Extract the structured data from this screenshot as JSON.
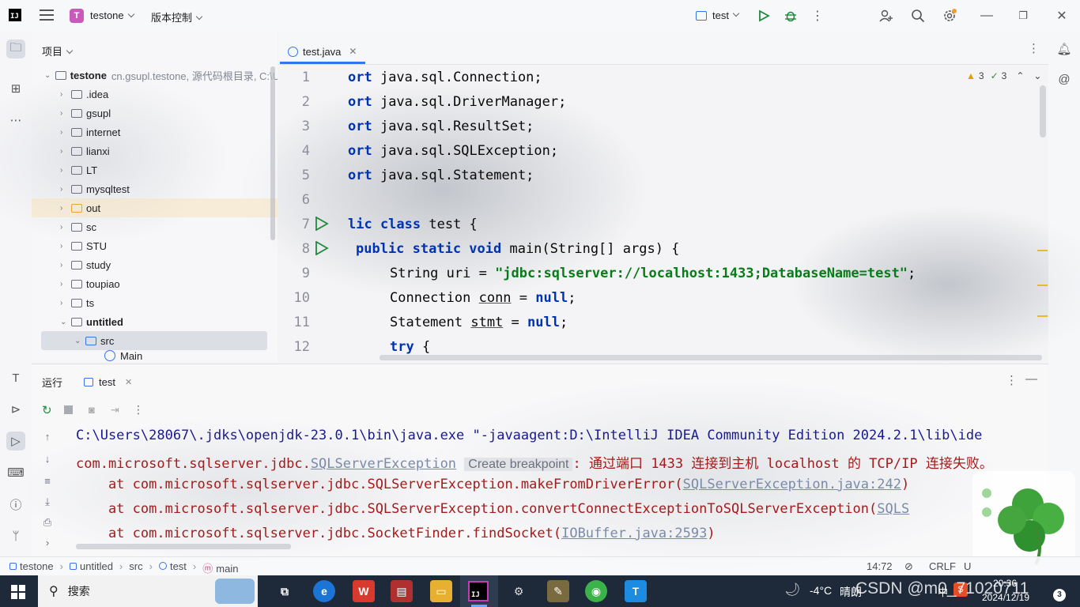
{
  "titlebar": {
    "project_initial": "T",
    "project_name": "testone",
    "vcs_label": "版本控制",
    "run_config": "test"
  },
  "project_panel": {
    "header": "项目",
    "root": {
      "name": "testone",
      "hint": "cn.gsupl.testone, 源代码根目录, C:\\U"
    },
    "items": [
      {
        "name": ".idea"
      },
      {
        "name": "gsupl"
      },
      {
        "name": "internet"
      },
      {
        "name": "lianxi"
      },
      {
        "name": "LT"
      },
      {
        "name": "mysqltest"
      },
      {
        "name": "out"
      },
      {
        "name": "sc"
      },
      {
        "name": "STU"
      },
      {
        "name": "study"
      },
      {
        "name": "toupiao"
      },
      {
        "name": "ts"
      },
      {
        "name": "untitled"
      },
      {
        "name": "src"
      },
      {
        "name": "Main"
      }
    ]
  },
  "editor": {
    "tab_name": "test.java",
    "warnings": "3",
    "weak_warnings": "3",
    "line_numbers": [
      "1",
      "2",
      "3",
      "4",
      "5",
      "6",
      "7",
      "8",
      "9",
      "10",
      "11",
      "12"
    ],
    "code": {
      "l1_kw": "ort",
      "l1_rest": " java.sql.Connection;",
      "l2_kw": "ort",
      "l2_rest": " java.sql.DriverManager;",
      "l3_kw": "ort",
      "l3_rest": " java.sql.ResultSet;",
      "l4_kw": "ort",
      "l4_rest": " java.sql.SQLException;",
      "l5_kw": "ort",
      "l5_rest": " java.sql.Statement;",
      "l7_kw": "lic class",
      "l7_rest": " test {",
      "l8_kw": "public static void",
      "l8_rest": " main(String[] args) {",
      "l9_a": "String uri = ",
      "l9_str": "\"jdbc:sqlserver://localhost:1433;DatabaseName=test\"",
      "l9_b": ";",
      "l10_a": "Connection ",
      "l10_var": "conn",
      "l10_b": " = ",
      "l10_kw": "null",
      "l10_c": ";",
      "l11_a": "Statement ",
      "l11_var": "stmt",
      "l11_b": " = ",
      "l11_kw": "null",
      "l11_c": ";",
      "l12_kw": "try",
      "l12_rest": " {"
    }
  },
  "run_panel": {
    "title": "运行",
    "tab": "test",
    "console": {
      "line1": "C:\\Users\\28067\\.jdks\\openjdk-23.0.1\\bin\\java.exe \"-javaagent:D:\\IntelliJ IDEA Community Edition 2024.2.1\\lib\\ide",
      "line2_a": "com.microsoft.sqlserver.jdbc.",
      "line2_link": "SQLServerException",
      "line2_chip": "Create breakpoint",
      "line2_b": ": 通过端口 1433 连接到主机 localhost 的 TCP/IP 连接失败。",
      "line3_a": "    at com.microsoft.sqlserver.jdbc.SQLServerException.makeFromDriverError(",
      "line3_link": "SQLServerException.java:242",
      "line3_b": ")",
      "line4_a": "    at com.microsoft.sqlserver.jdbc.SQLServerException.convertConnectExceptionToSQLServerException(",
      "line4_link": "SQLS",
      "line5_a": "    at com.microsoft.sqlserver.jdbc.SocketFinder.findSocket(",
      "line5_link": "IOBuffer.java:2593",
      "line5_b": ")"
    }
  },
  "statusbar": {
    "crumbs": [
      "testone",
      "untitled",
      "src",
      "test",
      "main"
    ],
    "position": "14:72",
    "line_sep": "CRLF",
    "encoding": "U"
  },
  "taskbar": {
    "search": "搜索",
    "weather_temp": "-4°C",
    "weather_desc": "晴朗",
    "ime": "中",
    "time": "20:36",
    "date": "2024/12/19",
    "notif_count": "3",
    "watermark": "CSDN @m0_71020711"
  },
  "colors": {
    "accent": "#3574f0",
    "keyword": "#0033b3",
    "string": "#067d17",
    "error": "#a51a1a",
    "run_green": "#208a3c"
  }
}
